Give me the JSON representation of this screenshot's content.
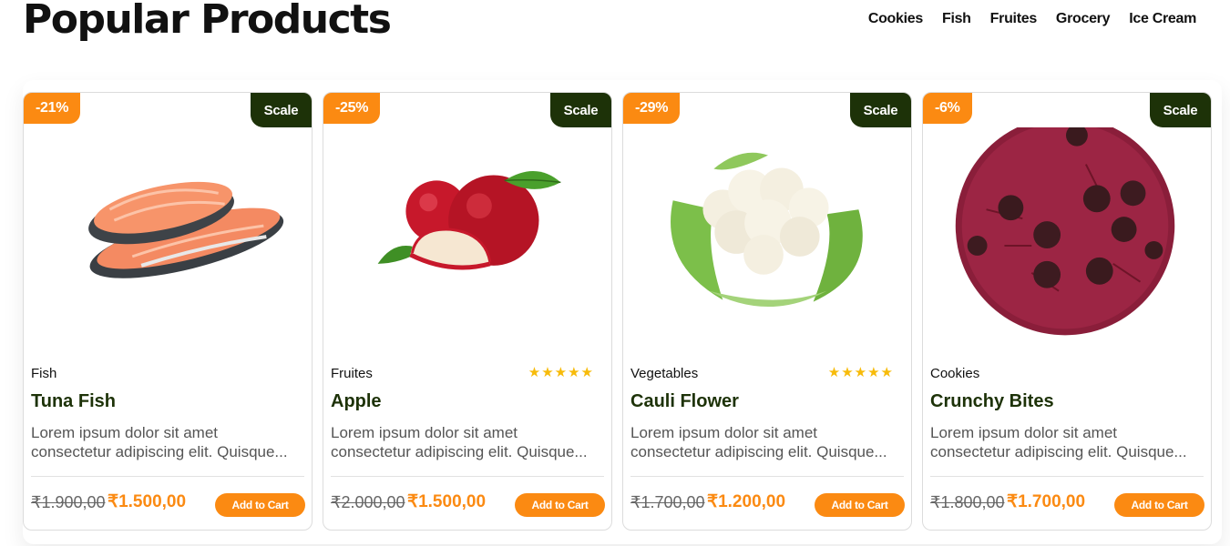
{
  "header": {
    "title": "Popular Products",
    "nav": [
      "Cookies",
      "Fish",
      "Fruites",
      "Grocery",
      "Ice Cream"
    ]
  },
  "colors": {
    "accent": "#fb8a12",
    "dark_green": "#1d3208",
    "star": "#f7bb0a"
  },
  "products": [
    {
      "discount": "-21%",
      "badge": "Scale",
      "image_icon": "salmon-steak",
      "category": "Fish",
      "rating": 0,
      "name": "Tuna Fish",
      "desc_line1": "Lorem ipsum dolor sit amet",
      "desc_line2": "consectetur adipiscing elit. Quisque...",
      "old_price": "₹1.900,00",
      "new_price": "₹1.500,00",
      "cart_label": "Add to Cart"
    },
    {
      "discount": "-25%",
      "badge": "Scale",
      "image_icon": "apples",
      "category": "Fruites",
      "rating": 5,
      "name": "Apple",
      "desc_line1": "Lorem ipsum dolor sit amet",
      "desc_line2": "consectetur adipiscing elit. Quisque...",
      "old_price": "₹2.000,00",
      "new_price": "₹1.500,00",
      "cart_label": "Add to Cart"
    },
    {
      "discount": "-29%",
      "badge": "Scale",
      "image_icon": "cauliflower",
      "category": "Vegetables",
      "rating": 5,
      "name": "Cauli Flower",
      "desc_line1": "Lorem ipsum dolor sit amet",
      "desc_line2": "consectetur adipiscing elit. Quisque...",
      "old_price": "₹1.700,00",
      "new_price": "₹1.200,00",
      "cart_label": "Add to Cart"
    },
    {
      "discount": "-6%",
      "badge": "Scale",
      "image_icon": "red-velvet-cookie",
      "category": "Cookies",
      "rating": 0,
      "name": "Crunchy Bites",
      "desc_line1": "Lorem ipsum dolor sit amet",
      "desc_line2": "consectetur adipiscing elit. Quisque...",
      "old_price": "₹1.800,00",
      "new_price": "₹1.700,00",
      "cart_label": "Add to Cart"
    }
  ]
}
